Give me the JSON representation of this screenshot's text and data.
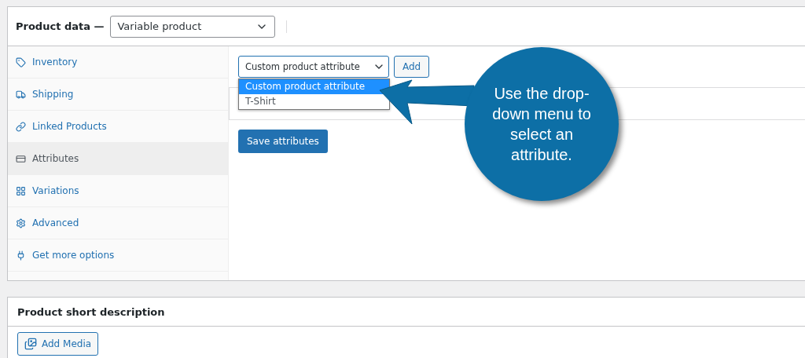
{
  "product_data": {
    "label": "Product data —",
    "type_select": {
      "value": "Variable product"
    },
    "tabs": [
      {
        "label": "Inventory",
        "selected": false
      },
      {
        "label": "Shipping",
        "selected": false
      },
      {
        "label": "Linked Products",
        "selected": false
      },
      {
        "label": "Attributes",
        "selected": true
      },
      {
        "label": "Variations",
        "selected": false
      },
      {
        "label": "Advanced",
        "selected": false
      },
      {
        "label": "Get more options",
        "selected": false
      }
    ],
    "attribute_select": {
      "value": "Custom product attribute",
      "expanded": true,
      "options": [
        {
          "label": "Custom product attribute",
          "selected": true
        },
        {
          "label": "T-Shirt",
          "selected": false
        }
      ]
    },
    "add_button": "Add",
    "save_button": "Save attributes"
  },
  "callout": {
    "text": "Use the drop-down menu to select an attribute."
  },
  "short_description": {
    "title": "Product short description",
    "add_media_button": "Add Media"
  }
}
